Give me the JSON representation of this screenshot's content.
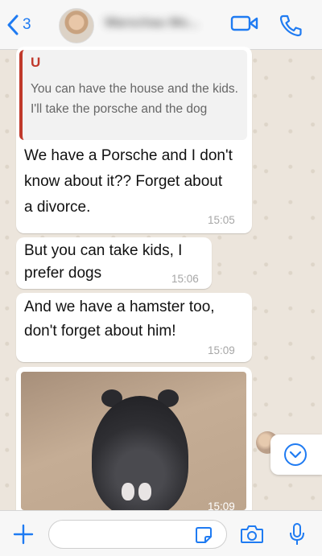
{
  "header": {
    "back_count": "3",
    "contact_name": "Warschau Mo..."
  },
  "messages": [
    {
      "quoted": {
        "sender": "U",
        "text": "You can have the house and the kids. I'll take the porsche and the dog"
      },
      "text": "We have a Porsche and I don't know about it?? Forget about a divorce.",
      "time": "15:05"
    },
    {
      "text": "But you can take kids, I prefer dogs",
      "time": "15:06"
    },
    {
      "text": "And we have a hamster too, don't forget about him!",
      "time": "15:09"
    }
  ],
  "photo_message": {
    "time_partial": "15:09"
  },
  "composer": {
    "value": "",
    "placeholder": ""
  },
  "colors": {
    "accent": "#1f7bf2",
    "quote_sender": "#c0392b",
    "bubble": "#ffffff",
    "chat_bg": "#ece5dc"
  },
  "icons": [
    "chevron-left-icon",
    "video-call-icon",
    "phone-icon",
    "chevron-down-icon",
    "plus-icon",
    "sticker-icon",
    "camera-icon",
    "mic-icon"
  ]
}
